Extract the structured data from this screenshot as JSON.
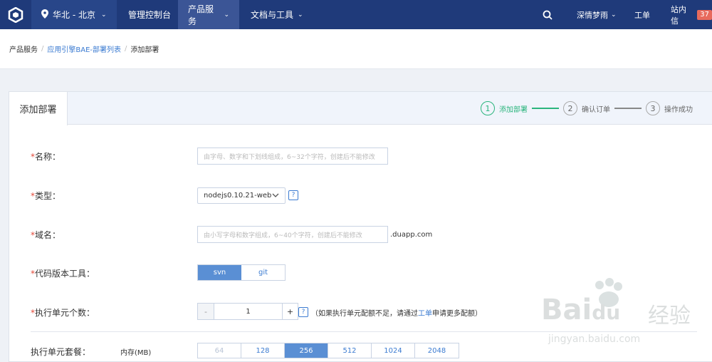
{
  "nav": {
    "region": "华北 - 北京",
    "items": [
      "管理控制台",
      "产品服务",
      "文档与工具"
    ],
    "user": "深情梦雨",
    "ticket": "工单",
    "inbox": "站内信",
    "inbox_count": "37"
  },
  "breadcrumb": {
    "root": "产品服务",
    "link": "应用引擎BAE-部署列表",
    "current": "添加部署"
  },
  "panel": {
    "tab": "添加部署",
    "steps": [
      {
        "num": "1",
        "label": "添加部署"
      },
      {
        "num": "2",
        "label": "确认订单"
      },
      {
        "num": "3",
        "label": "操作成功"
      }
    ]
  },
  "form": {
    "name": {
      "label": "名称：",
      "placeholder": "由字母、数字和下划线组成，6~32个字符，创建后不能修改"
    },
    "type": {
      "label": "类型：",
      "value": "nodejs0.10.21-web",
      "help": "?"
    },
    "domain": {
      "label": "域名：",
      "placeholder": "由小写字母和数字组成，6~40个字符，创建后不能修改",
      "suffix": ".duapp.com"
    },
    "vcs": {
      "label": "代码版本工具：",
      "options": [
        "svn",
        "git"
      ],
      "selected": "svn"
    },
    "units": {
      "label": "执行单元个数：",
      "minus": "-",
      "value": "1",
      "plus": "+",
      "help": "?",
      "note_prefix": "（如果执行单元配额不足，请通过",
      "note_link": "工单",
      "note_suffix": "申请更多配额）"
    },
    "package": {
      "label": "执行单元套餐：",
      "sub": "内存(MB)",
      "options": [
        "64",
        "128",
        "256",
        "512",
        "1024",
        "2048"
      ],
      "selected": "256"
    }
  },
  "watermark": {
    "brand": "Bai",
    "brand2": "du",
    "cn": "经验",
    "url": "jingyan.baidu.com"
  }
}
